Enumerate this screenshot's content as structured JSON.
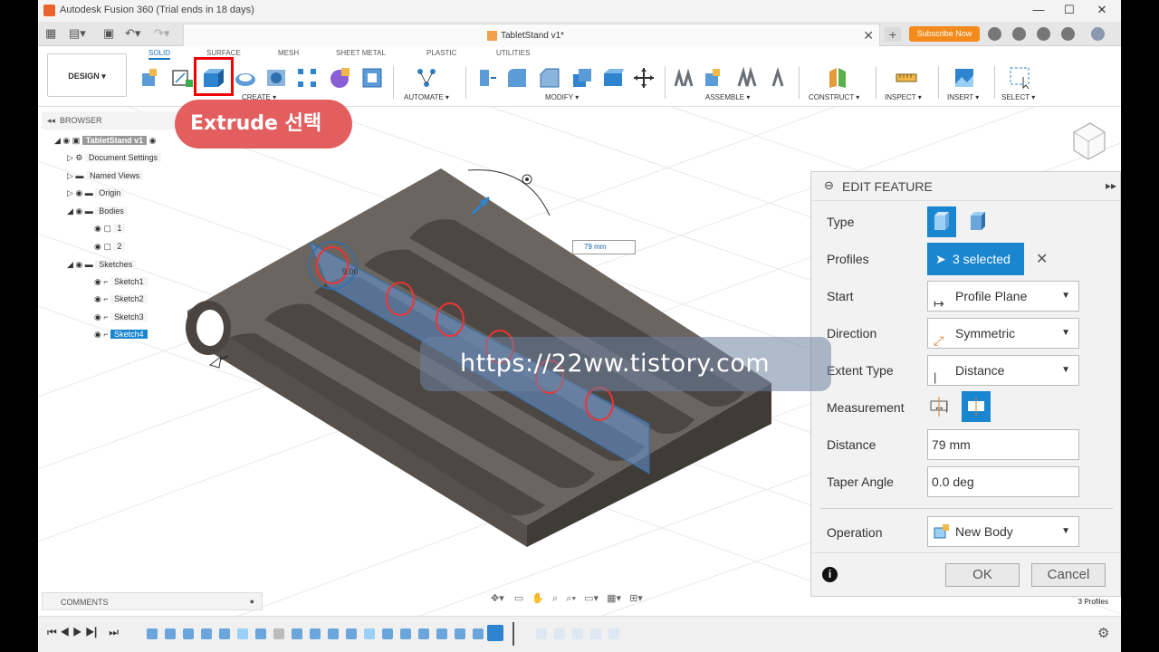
{
  "window": {
    "title": "Autodesk Fusion 360 (Trial ends in 18 days)"
  },
  "tabbar": {
    "doc_title": "TabletStand v1*",
    "subscribe_label": "Subscribe Now"
  },
  "workspace": {
    "label": "DESIGN ▾"
  },
  "ribbon_tabs": [
    "SOLID",
    "SURFACE",
    "MESH",
    "SHEET METAL",
    "PLASTIC",
    "UTILITIES"
  ],
  "ribbon_groups": [
    "CREATE ▾",
    "AUTOMATE ▾",
    "MODIFY ▾",
    "ASSEMBLE ▾",
    "CONSTRUCT ▾",
    "INSPECT ▾",
    "INSERT ▾",
    "SELECT ▾"
  ],
  "callout": {
    "text": "Extrude 선택"
  },
  "browser": {
    "title": "BROWSER",
    "items": [
      {
        "label": "TabletStand v1"
      },
      {
        "label": "Document Settings"
      },
      {
        "label": "Named Views"
      },
      {
        "label": "Origin"
      },
      {
        "label": "Bodies"
      },
      {
        "label": "1"
      },
      {
        "label": "2"
      },
      {
        "label": "Sketches"
      },
      {
        "label": "Sketch1"
      },
      {
        "label": "Sketch2"
      },
      {
        "label": "Sketch3"
      },
      {
        "label": "Sketch4"
      }
    ]
  },
  "comments": {
    "label": "COMMENTS"
  },
  "viewport": {
    "dimension_value": "79 mm",
    "angle_label": "9.00"
  },
  "watermark": {
    "text": "https://22ww.tistory.com"
  },
  "edit_feature": {
    "title": "EDIT FEATURE",
    "type_label": "Type",
    "profiles_label": "Profiles",
    "profiles_value": "3 selected",
    "start_label": "Start",
    "start_value": "Profile Plane",
    "direction_label": "Direction",
    "direction_value": "Symmetric",
    "extent_label": "Extent Type",
    "extent_value": "Distance",
    "measurement_label": "Measurement",
    "distance_label": "Distance",
    "distance_value": "79 mm",
    "taper_label": "Taper Angle",
    "taper_value": "0.0 deg",
    "operation_label": "Operation",
    "operation_value": "New Body",
    "ok_label": "OK",
    "cancel_label": "Cancel"
  },
  "status": {
    "profiles": "3 Profiles"
  },
  "colors": {
    "accent": "#1a86d0",
    "callout": "#e35f5f",
    "highlight": "#e00000",
    "body": "#5a5550"
  }
}
